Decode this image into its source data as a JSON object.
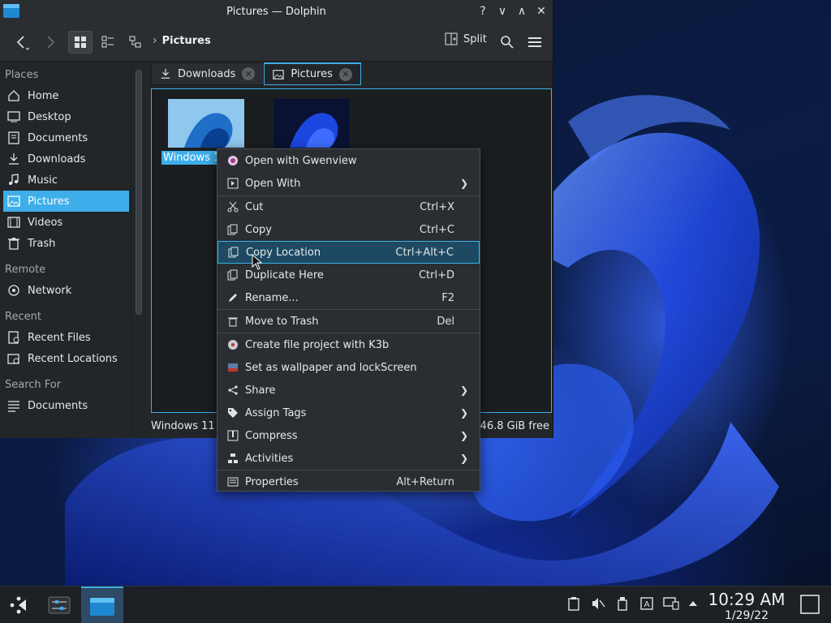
{
  "window": {
    "title": "Pictures — Dolphin",
    "breadcrumb": "Pictures",
    "split_label": "Split"
  },
  "sidebar": {
    "places_header": "Places",
    "places": [
      "Home",
      "Desktop",
      "Documents",
      "Downloads",
      "Music",
      "Pictures",
      "Videos",
      "Trash"
    ],
    "remote_header": "Remote",
    "remote": [
      "Network"
    ],
    "recent_header": "Recent",
    "recent": [
      "Recent Files",
      "Recent Locations"
    ],
    "search_header": "Search For",
    "search": [
      "Documents"
    ]
  },
  "tabs": [
    {
      "label": "Downloads"
    },
    {
      "label": "Pictures"
    }
  ],
  "files": {
    "selected_name": "Windows 1"
  },
  "statusbar": {
    "left": "Windows 11 .",
    "free": "46.8 GiB free"
  },
  "context_menu": {
    "items": [
      {
        "label": "Open with Gwenview",
        "shortcut": ""
      },
      {
        "label": "Open With",
        "shortcut": ""
      },
      {
        "label": "Cut",
        "shortcut": "Ctrl+X"
      },
      {
        "label": "Copy",
        "shortcut": "Ctrl+C"
      },
      {
        "label": "Copy Location",
        "shortcut": "Ctrl+Alt+C"
      },
      {
        "label": "Duplicate Here",
        "shortcut": "Ctrl+D"
      },
      {
        "label": "Rename...",
        "shortcut": "F2"
      },
      {
        "label": "Move to Trash",
        "shortcut": "Del"
      },
      {
        "label": "Create file project with K3b",
        "shortcut": ""
      },
      {
        "label": "Set as wallpaper and lockScreen",
        "shortcut": ""
      },
      {
        "label": "Share",
        "shortcut": ""
      },
      {
        "label": "Assign Tags",
        "shortcut": ""
      },
      {
        "label": "Compress",
        "shortcut": ""
      },
      {
        "label": "Activities",
        "shortcut": ""
      },
      {
        "label": "Properties",
        "shortcut": "Alt+Return"
      }
    ]
  },
  "taskbar": {
    "time": "10:29 AM",
    "date": "1/29/22"
  },
  "colors": {
    "accent": "#3daee9",
    "window_bg": "#232629",
    "menu_highlight": "#1d4a62"
  }
}
